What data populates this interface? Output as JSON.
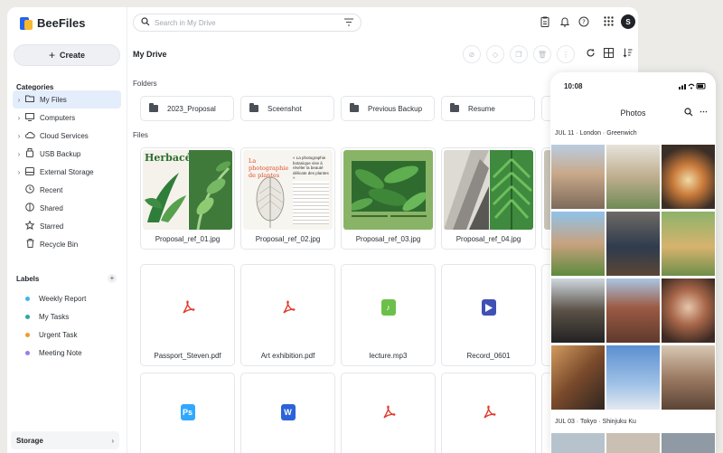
{
  "app": {
    "name": "BeeFiles"
  },
  "sidebar": {
    "create_label": "Create",
    "categories_title": "Categories",
    "categories": [
      {
        "label": "My Files",
        "icon": "folder-icon",
        "caret": true,
        "active": true
      },
      {
        "label": "Computers",
        "icon": "monitor-icon",
        "caret": true
      },
      {
        "label": "Cloud Services",
        "icon": "cloud-icon",
        "caret": true
      },
      {
        "label": "USB Backup",
        "icon": "usb-icon",
        "caret": true
      },
      {
        "label": "External Storage",
        "icon": "drive-icon",
        "caret": true
      },
      {
        "label": "Recent",
        "icon": "clock-icon"
      },
      {
        "label": "Shared",
        "icon": "shared-icon"
      },
      {
        "label": "Starred",
        "icon": "star-icon"
      },
      {
        "label": "Recycle Bin",
        "icon": "trash-icon"
      }
    ],
    "labels_title": "Labels",
    "labels": [
      {
        "label": "Weekly Report",
        "color": "#3fb6e8"
      },
      {
        "label": "My Tasks",
        "color": "#2fa7a0"
      },
      {
        "label": "Urgent Task",
        "color": "#f29a2e"
      },
      {
        "label": "Meeting Note",
        "color": "#9b7fe3"
      }
    ],
    "storage_label": "Storage"
  },
  "search": {
    "placeholder": "Search in My Drive"
  },
  "avatar_initial": "S",
  "page_title": "My Drive",
  "folders_title": "Folders",
  "folders": [
    "2023_Proposal",
    "Sceenshot",
    "Previous Backup",
    "Resume"
  ],
  "files_title": "Files",
  "files_row1": [
    "Proposal_ref_01.jpg",
    "Proposal_ref_02.jpg",
    "Proposal_ref_03.jpg",
    "Proposal_ref_04.jpg"
  ],
  "files_row2": [
    {
      "name": "Passport_Steven.pdf",
      "type": "pdf"
    },
    {
      "name": "Art exhibition.pdf",
      "type": "pdf"
    },
    {
      "name": "lecture.mp3",
      "type": "audio"
    },
    {
      "name": "Record_0601",
      "type": "video"
    }
  ],
  "files_row3": [
    {
      "type": "photoshop",
      "glyph": "Ps"
    },
    {
      "type": "word",
      "glyph": "W"
    },
    {
      "type": "pdf"
    },
    {
      "type": "pdf"
    }
  ],
  "thumb_text": {
    "herbacee": "Herbacée",
    "photographie": "La photographie de plantes",
    "quote": "« La photographie botanique vise à révéler la beauté délicate des plantes »"
  },
  "phone": {
    "time": "10:08",
    "title": "Photos",
    "section1": "JUL 11 · London · Greenwich",
    "section2": "JUL 03 · Tokyo · Shinjuku Ku"
  },
  "colors": {
    "accent": "#2563eb",
    "logo_yellow": "#f5b82e",
    "pdf_red": "#e0392b",
    "audio_green": "#6cc04a",
    "video_blue": "#3f51b5",
    "ps_blue": "#31a8ff",
    "word_blue": "#2b63d9"
  }
}
